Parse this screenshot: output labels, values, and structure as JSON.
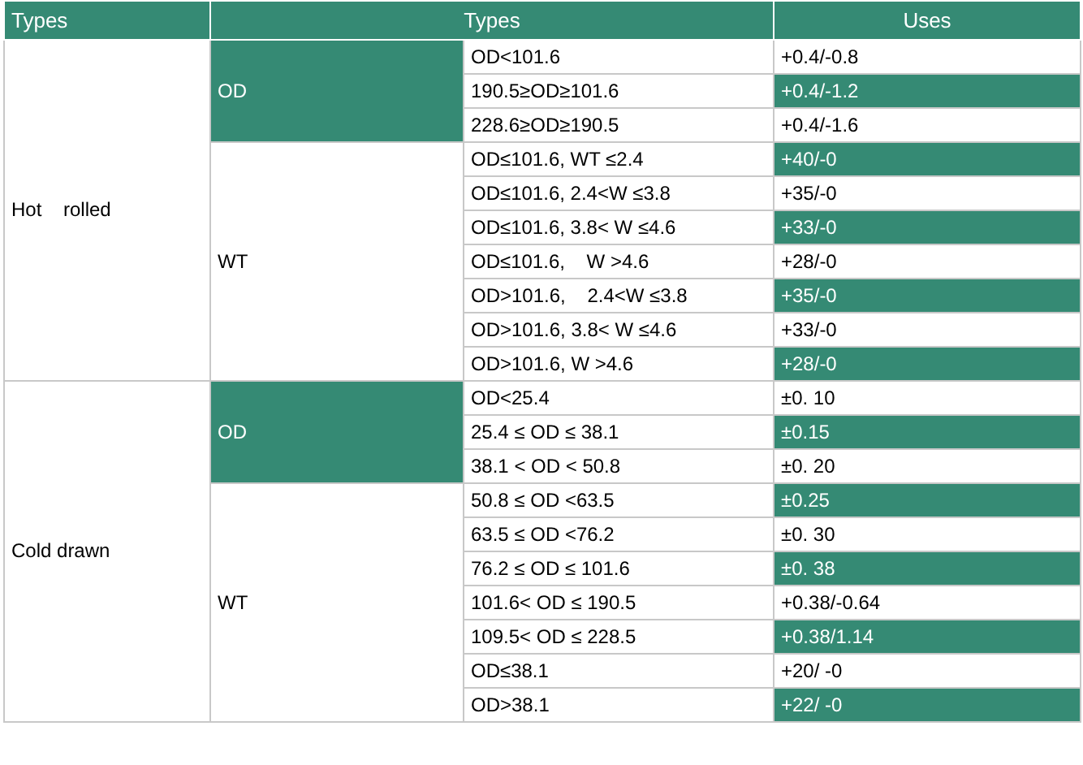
{
  "header": [
    "Types",
    "Types",
    "Uses"
  ],
  "groups": [
    {
      "name": "Hot    rolled",
      "subgroups": [
        {
          "name": "OD",
          "highlighted": true,
          "rows": [
            {
              "type": "OD<101.6",
              "use": "+0.4/-0.8",
              "highlighted": false
            },
            {
              "type": "190.5≥OD≥101.6",
              "use": "+0.4/-1.2",
              "highlighted": true
            },
            {
              "type": "228.6≥OD≥190.5",
              "use": "+0.4/-1.6",
              "highlighted": false
            }
          ]
        },
        {
          "name": "WT",
          "highlighted": false,
          "rows": [
            {
              "type": "OD≤101.6, WT ≤2.4",
              "use": "+40/-0",
              "highlighted": true
            },
            {
              "type": "OD≤101.6, 2.4<W ≤3.8",
              "use": "+35/-0",
              "highlighted": false
            },
            {
              "type": "OD≤101.6, 3.8< W ≤4.6",
              "use": "+33/-0",
              "highlighted": true
            },
            {
              "type": "OD≤101.6,    W >4.6",
              "use": "+28/-0",
              "highlighted": false
            },
            {
              "type": "OD>101.6,    2.4<W ≤3.8",
              "use": "+35/-0",
              "highlighted": true
            },
            {
              "type": "OD>101.6, 3.8< W ≤4.6",
              "use": "+33/-0",
              "highlighted": false
            },
            {
              "type": "OD>101.6, W >4.6",
              "use": "+28/-0",
              "highlighted": true
            }
          ]
        }
      ]
    },
    {
      "name": "Cold drawn",
      "subgroups": [
        {
          "name": "OD",
          "highlighted": true,
          "rows": [
            {
              "type": "OD<25.4",
              "use": "±0. 10",
              "highlighted": false
            },
            {
              "type": "25.4 ≤ OD ≤ 38.1",
              "use": "±0.15",
              "highlighted": true
            },
            {
              "type": "38.1 < OD < 50.8",
              "use": "±0. 20",
              "highlighted": false
            }
          ]
        },
        {
          "name": "WT",
          "highlighted": false,
          "rows": [
            {
              "type": "50.8 ≤ OD <63.5",
              "use": "±0.25",
              "highlighted": true
            },
            {
              "type": "63.5 ≤ OD <76.2",
              "use": "±0. 30",
              "highlighted": false
            },
            {
              "type": "76.2 ≤ OD ≤ 101.6",
              "use": "±0. 38",
              "highlighted": true
            },
            {
              "type": "101.6< OD ≤ 190.5",
              "use": "+0.38/-0.64",
              "highlighted": false
            },
            {
              "type": "109.5< OD ≤ 228.5",
              "use": "+0.38/1.14",
              "highlighted": true
            },
            {
              "type": "OD≤38.1",
              "use": "+20/ -0",
              "highlighted": false
            },
            {
              "type": "OD>38.1",
              "use": "+22/ -0",
              "highlighted": true
            }
          ]
        }
      ]
    }
  ]
}
